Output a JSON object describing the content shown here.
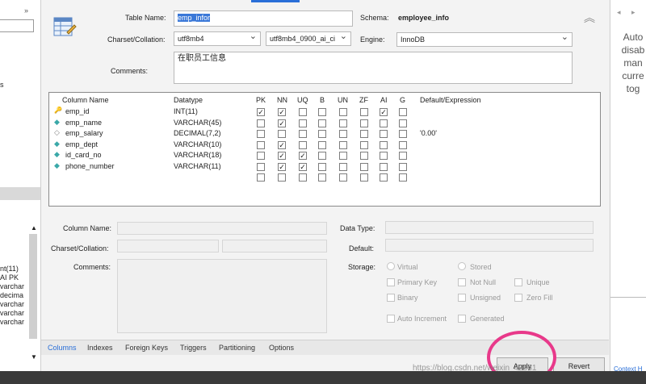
{
  "table": {
    "name_label": "Table Name:",
    "name_value": "emp_infor",
    "schema_label": "Schema:",
    "schema_value": "employee_info",
    "charset_label": "Charset/Collation:",
    "charset_value": "utf8mb4",
    "collation_value": "utf8mb4_0900_ai_ci",
    "engine_label": "Engine:",
    "engine_value": "InnoDB",
    "comments_label": "Comments:",
    "comments_value": "在职员工信息"
  },
  "grid": {
    "headers": [
      "Column Name",
      "Datatype",
      "PK",
      "NN",
      "UQ",
      "B",
      "UN",
      "ZF",
      "AI",
      "G",
      "Default/Expression"
    ],
    "rows": [
      {
        "name": "emp_id",
        "type": "INT(11)",
        "flags": [
          true,
          true,
          false,
          false,
          false,
          false,
          true,
          false
        ],
        "default": "",
        "icon": "key-icon"
      },
      {
        "name": "emp_name",
        "type": "VARCHAR(45)",
        "flags": [
          false,
          true,
          false,
          false,
          false,
          false,
          false,
          false
        ],
        "default": "",
        "icon": "diamond-icon"
      },
      {
        "name": "emp_salary",
        "type": "DECIMAL(7,2)",
        "flags": [
          false,
          false,
          false,
          false,
          false,
          false,
          false,
          false
        ],
        "default": "'0.00'",
        "icon": "diamond-outline-icon"
      },
      {
        "name": "emp_dept",
        "type": "VARCHAR(10)",
        "flags": [
          false,
          true,
          false,
          false,
          false,
          false,
          false,
          false
        ],
        "default": "",
        "icon": "diamond-icon"
      },
      {
        "name": "id_card_no",
        "type": "VARCHAR(18)",
        "flags": [
          false,
          true,
          true,
          false,
          false,
          false,
          false,
          false
        ],
        "default": "",
        "icon": "diamond-icon"
      },
      {
        "name": "phone_number",
        "type": "VARCHAR(11)",
        "flags": [
          false,
          true,
          true,
          false,
          false,
          false,
          false,
          false
        ],
        "default": "",
        "icon": "diamond-icon"
      },
      {
        "name": "",
        "type": "",
        "flags": [
          false,
          false,
          false,
          false,
          false,
          false,
          false,
          false
        ],
        "default": "",
        "icon": ""
      }
    ]
  },
  "details": {
    "column_name_label": "Column Name:",
    "charset_label": "Charset/Collation:",
    "comments_label": "Comments:",
    "data_type_label": "Data Type:",
    "default_label": "Default:",
    "storage_label": "Storage:",
    "virtual": "Virtual",
    "stored": "Stored",
    "primary_key": "Primary Key",
    "not_null": "Not Null",
    "unique": "Unique",
    "binary": "Binary",
    "unsigned": "Unsigned",
    "zero_fill": "Zero Fill",
    "auto_increment": "Auto Increment",
    "generated": "Generated"
  },
  "tabs": [
    "Columns",
    "Indexes",
    "Foreign Keys",
    "Triggers",
    "Partitioning",
    "Options"
  ],
  "buttons": {
    "apply": "Apply",
    "revert": "Revert"
  },
  "left_panel": {
    "items": [
      "nt(11)",
      "AI PK",
      "varchar",
      "decima",
      "varchar",
      "varchar",
      "varchar"
    ],
    "s_char": "s"
  },
  "right_panel": {
    "lines": [
      "Auto",
      "disab",
      "man",
      "curre",
      "tog"
    ],
    "context_label": "Context H"
  },
  "watermark": "https://blog.csdn.net/weixin_43561"
}
